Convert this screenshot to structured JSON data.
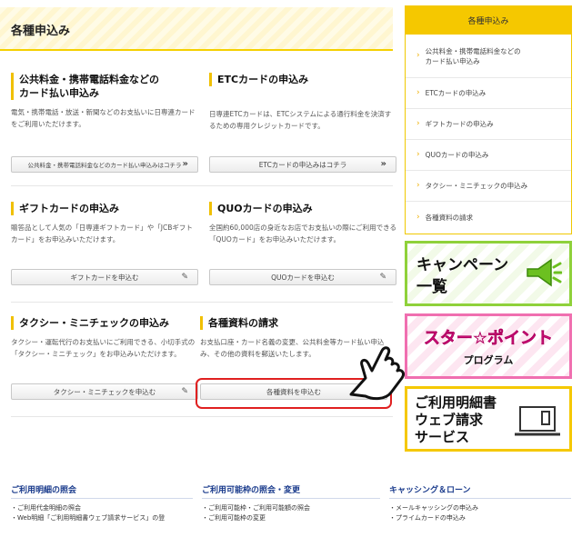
{
  "header": {
    "title": "各種申込み"
  },
  "cards": [
    {
      "title_lines": [
        "公共料金・携帯電話料金などの",
        "カード払い申込み"
      ],
      "desc": "電気・携帯電話・放送・新聞などのお支払いに日専連カードをご利用いただけます。",
      "button": "公共料金・携帯電話料金などのカード払い申込みはコチラ",
      "button_icon": "chevron-double-right-icon"
    },
    {
      "title_lines": [
        "ETCカードの申込み"
      ],
      "desc": "日専連ETCカードは、ETCシステムによる通行料金を決済するための専用クレジットカードです。",
      "button": "ETCカードの申込みはコチラ",
      "button_icon": "chevron-double-right-icon"
    },
    {
      "title_lines": [
        "ギフトカードの申込み"
      ],
      "desc": "贈答品として人気の「日専連ギフトカード」や「JCBギフトカード」をお申込みいただけます。",
      "button": "ギフトカードを申込む",
      "button_icon": "pencil-note-icon"
    },
    {
      "title_lines": [
        "QUOカードの申込み"
      ],
      "desc": "全国約60,000店の身近なお店でお支払いの際にご利用できる「QUOカード」をお申込みいただけます。",
      "button": "QUOカードを申込む",
      "button_icon": "pencil-note-icon"
    },
    {
      "title_lines": [
        "タクシー・ミニチェックの申込み"
      ],
      "desc": "タクシー・運転代行のお支払いにご利用できる、小切手式の「タクシー・ミニチェック」をお申込みいただけます。",
      "button": "タクシー・ミニチェックを申込む",
      "button_icon": "pencil-note-icon"
    },
    {
      "title_lines": [
        "各種資料の請求"
      ],
      "desc": "お支払口座・カード名義の変更、公共料金等カード払い申込み、その他の資料を郵送いたします。",
      "button": "各種資料を申込む",
      "button_icon": "pencil-note-icon"
    }
  ],
  "sidebar": {
    "heading": "各種申込み",
    "items": [
      [
        "公共料金・携帯電話料金などの",
        "カード払い申込み"
      ],
      [
        "ETCカードの申込み"
      ],
      [
        "ギフトカードの申込み"
      ],
      [
        "QUOカードの申込み"
      ],
      [
        "タクシー・ミニチェックの申込み"
      ],
      [
        "各種資料の請求"
      ]
    ],
    "banners": {
      "campaign": [
        "キャンペーン",
        "一覧"
      ],
      "star_point": [
        "スター☆ポイント",
        "プログラム"
      ],
      "web_statement": [
        "ご利用明細書",
        "ウェブ請求",
        "サービス"
      ]
    }
  },
  "footer": {
    "columns": [
      {
        "title": "ご利用明細の照会",
        "items": [
          "ご利用代金明細の照会",
          "Web明細「ご利用明細書ウェブ請求サービス」の登"
        ]
      },
      {
        "title": "ご利用可能枠の照会・変更",
        "items": [
          "ご利用可能枠・ご利用可能額の照会",
          "ご利用可能枠の変更"
        ]
      },
      {
        "title": "キャッシング＆ローン",
        "items": [
          "メールキャッシングの申込み",
          "プライムカードの申込み"
        ]
      }
    ]
  },
  "colors": {
    "accent": "#f5c800",
    "highlight": "#e02020",
    "campaign": "#8fd13a",
    "star": "#f06fb0",
    "link": "#1a3b8c"
  }
}
